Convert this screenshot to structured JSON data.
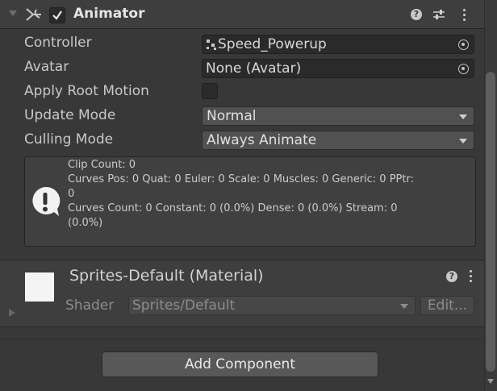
{
  "animator": {
    "title": "Animator",
    "enabled": true,
    "properties": {
      "controller": {
        "label": "Controller",
        "value": "Speed_Powerup"
      },
      "avatar": {
        "label": "Avatar",
        "value": "None (Avatar)"
      },
      "apply_root_motion": {
        "label": "Apply Root Motion",
        "checked": false
      },
      "update_mode": {
        "label": "Update Mode",
        "value": "Normal"
      },
      "culling_mode": {
        "label": "Culling Mode",
        "value": "Always Animate"
      }
    },
    "info": {
      "line1": "Clip Count: 0",
      "line2": "Curves Pos: 0 Quat: 0 Euler: 0 Scale: 0 Muscles: 0 Generic: 0 PPtr:",
      "line3": "0",
      "line4": "Curves Count: 0 Constant: 0 (0.0%) Dense: 0 (0.0%) Stream: 0",
      "line5": "(0.0%)"
    },
    "help_glyph": "?"
  },
  "material": {
    "title": "Sprites-Default (Material)",
    "shader_label": "Shader",
    "shader_value": "Sprites/Default",
    "edit_label": "Edit...",
    "help_glyph": "?"
  },
  "add_component_label": "Add Component",
  "icons": {
    "animator": "animator-component-icon",
    "info": "info-exclamation-icon",
    "picker": "object-picker-icon",
    "presets": "presets-sliders-icon",
    "menu": "kebab-menu-icon"
  }
}
